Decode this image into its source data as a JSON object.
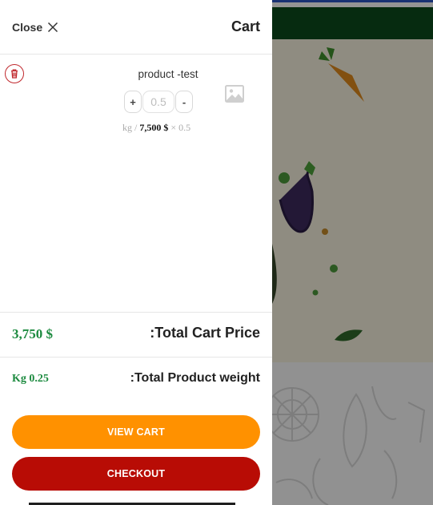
{
  "header": {
    "close_label": "Close",
    "cart_title": "Cart"
  },
  "item": {
    "name": "product -test",
    "qty_plus": "+",
    "qty_minus": "-",
    "qty_value": "0.5",
    "unit": "kg",
    "price_sep": "/",
    "price": "7,500 $",
    "multiplier": "× 0.5"
  },
  "totals": {
    "price_value": "3,750 $",
    "price_label": ":Total Cart Price",
    "weight_value": "Kg 0.25",
    "weight_label": ":Total Product weight"
  },
  "buttons": {
    "view_cart": "VIEW CART",
    "checkout": "CHECKOUT"
  },
  "colors": {
    "accent_orange": "#ff9100",
    "checkout_red": "#b80c05",
    "price_green": "#1c8a3f"
  }
}
